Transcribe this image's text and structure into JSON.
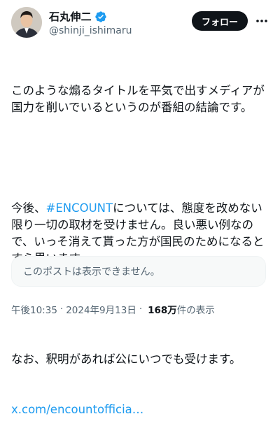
{
  "user": {
    "display_name": "石丸伸二",
    "handle": "@shinji_ishimaru",
    "verified": true
  },
  "follow_label": "フォロー",
  "tweet": {
    "line1": "このような煽るタイトルを平気で出すメディアが国力を削いでいるというのが番組の結論です。",
    "p2_prefix": "今後、",
    "hashtag": "#ENCOUNT",
    "p2_suffix": "については、態度を改めない限り一切の取材を受けません。良い悪い例なので、いっそ消えて貰った方が国民のためになるとすら思います。",
    "p3": "なお、釈明があれば公にいつでも受けます。",
    "link": "x.com/encountofficia…"
  },
  "quote_unavailable": "このポストは表示できません。",
  "meta": {
    "time": "午後10:35",
    "date": "2024年9月13日",
    "views_count": "168万",
    "views_suffix": "件の表示"
  },
  "colors": {
    "accent": "#1d9bf0",
    "text": "#0f1419",
    "muted": "#536471"
  }
}
